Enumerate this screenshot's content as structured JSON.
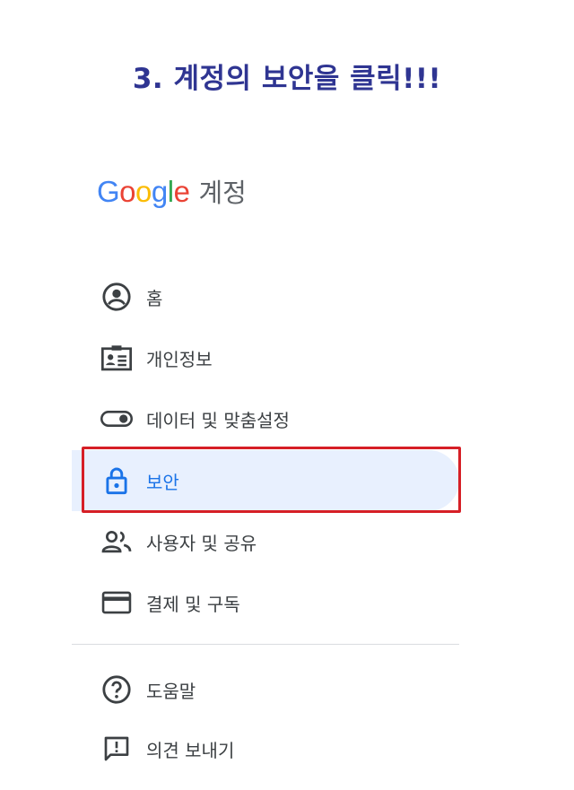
{
  "heading": "3. 계정의 보안을 클릭!!!",
  "brand": {
    "logo_letters": [
      "G",
      "o",
      "o",
      "g",
      "l",
      "e"
    ],
    "logo_colors": [
      "#4285F4",
      "#EA4335",
      "#FBBC05",
      "#4285F4",
      "#34A853",
      "#EA4335"
    ],
    "product": "계정"
  },
  "nav": {
    "items": [
      {
        "label": "홈",
        "icon": "account-circle-icon"
      },
      {
        "label": "개인정보",
        "icon": "id-card-icon"
      },
      {
        "label": "데이터 및 맞춤설정",
        "icon": "toggle-icon"
      },
      {
        "label": "보안",
        "icon": "lock-icon",
        "active": true
      },
      {
        "label": "사용자 및 공유",
        "icon": "people-icon"
      },
      {
        "label": "결제 및 구독",
        "icon": "credit-card-icon"
      }
    ],
    "secondary": [
      {
        "label": "도움말",
        "icon": "help-icon"
      },
      {
        "label": "의견 보내기",
        "icon": "feedback-icon"
      }
    ]
  },
  "colors": {
    "heading": "#2f3592",
    "active_bg": "#e8f0fe",
    "active_text": "#1a73e8",
    "highlight_border": "#d61f26"
  }
}
